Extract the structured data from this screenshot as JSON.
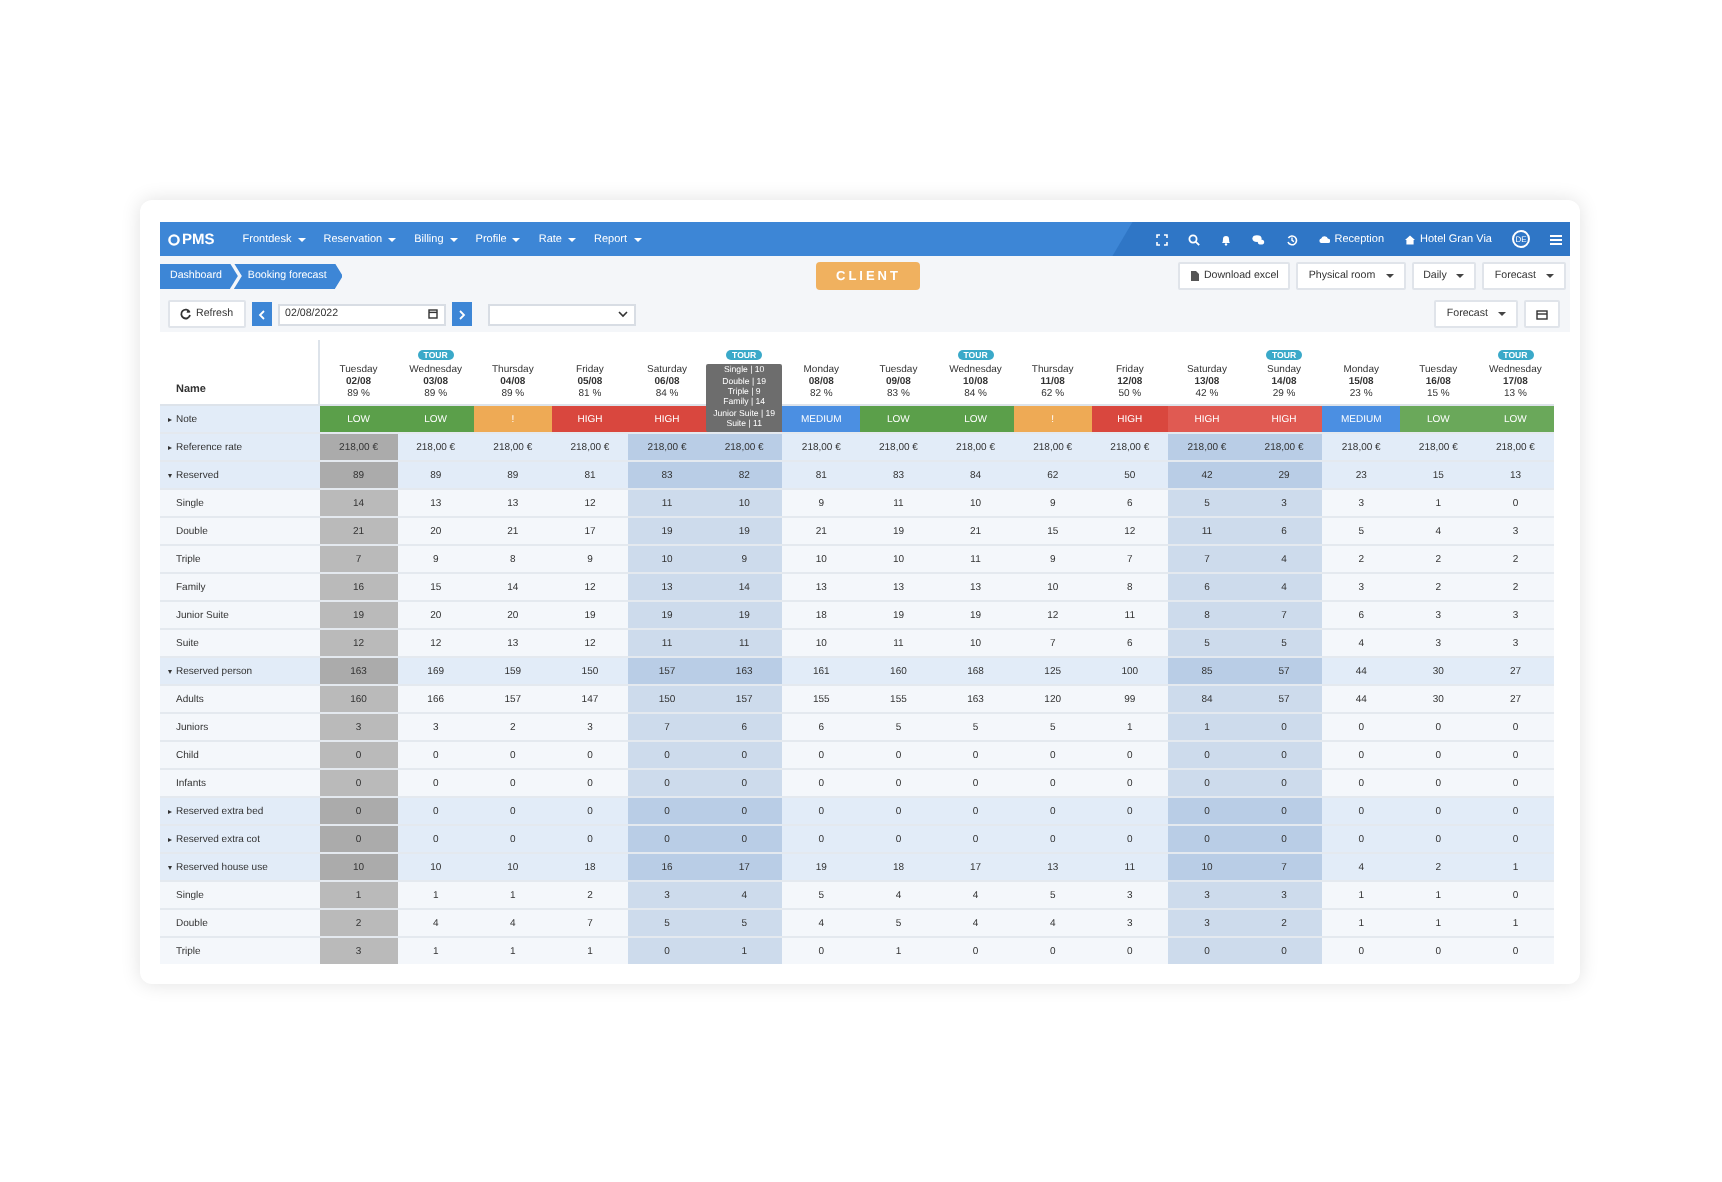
{
  "navbar": {
    "logo": "PMS",
    "menu": [
      "Frontdesk",
      "Reservation",
      "Billing",
      "Profile",
      "Rate",
      "Report"
    ],
    "reception": "Reception",
    "hotel": "Hotel Gran Via",
    "avatar": "DE"
  },
  "breadcrumb": [
    "Dashboard",
    "Booking forecast"
  ],
  "badge": "CLIENT",
  "actions": [
    {
      "label": "Download excel",
      "kind": "download"
    },
    {
      "label": "Physical room",
      "kind": "dropdown"
    },
    {
      "label": "Daily",
      "kind": "dropdown"
    },
    {
      "label": "Forecast",
      "kind": "dropdown"
    }
  ],
  "filter": {
    "refresh": "Refresh",
    "date": "02/08/2022",
    "view": "Forecast"
  },
  "table": {
    "name_header": "Name",
    "columns": [
      {
        "day": "Tuesday",
        "date": "02/08",
        "occupancy": "89 %",
        "today": true,
        "weekend": false
      },
      {
        "day": "Wednesday",
        "date": "03/08",
        "occupancy": "89 %",
        "badge": "TOUR",
        "today": false,
        "weekend": false
      },
      {
        "day": "Thursday",
        "date": "04/08",
        "occupancy": "89 %",
        "today": false,
        "weekend": false
      },
      {
        "day": "Friday",
        "date": "05/08",
        "occupancy": "81 %",
        "today": false,
        "weekend": false
      },
      {
        "day": "Saturday",
        "date": "06/08",
        "occupancy": "84 %",
        "today": false,
        "weekend": true
      },
      {
        "badge": "TOUR",
        "today": false,
        "weekend": true,
        "tooltip": [
          "Single | 10",
          "Double | 19",
          "Triple | 9",
          "Family | 14",
          "Junior Suite | 19",
          "Suite | 11"
        ]
      },
      {
        "day": "Monday",
        "date": "08/08",
        "occupancy": "82 %",
        "today": false,
        "weekend": false
      },
      {
        "day": "Tuesday",
        "date": "09/08",
        "occupancy": "83 %",
        "today": false,
        "weekend": false
      },
      {
        "day": "Wednesday",
        "date": "10/08",
        "occupancy": "84 %",
        "badge": "TOUR",
        "today": false,
        "weekend": false
      },
      {
        "day": "Thursday",
        "date": "11/08",
        "occupancy": "62 %",
        "today": false,
        "weekend": false
      },
      {
        "day": "Friday",
        "date": "12/08",
        "occupancy": "50 %",
        "today": false,
        "weekend": false
      },
      {
        "day": "Saturday",
        "date": "13/08",
        "occupancy": "42 %",
        "today": false,
        "weekend": true
      },
      {
        "day": "Sunday",
        "date": "14/08",
        "occupancy": "29 %",
        "badge": "TOUR",
        "today": false,
        "weekend": true
      },
      {
        "day": "Monday",
        "date": "15/08",
        "occupancy": "23 %",
        "today": false,
        "weekend": false
      },
      {
        "day": "Tuesday",
        "date": "16/08",
        "occupancy": "15 %",
        "today": false,
        "weekend": false
      },
      {
        "day": "Wednesday",
        "date": "17/08",
        "occupancy": "13 %",
        "badge": "TOUR",
        "today": false,
        "weekend": false
      }
    ],
    "rows": [
      {
        "label": "Note",
        "kind": "note",
        "expanded": false,
        "notes": [
          {
            "label": "LOW",
            "color": "#5b9f4a"
          },
          {
            "label": "LOW",
            "color": "#5b9f4a"
          },
          {
            "label": "!",
            "color": "#eeaa55"
          },
          {
            "label": "HIGH",
            "color": "#d9473e"
          },
          {
            "label": "HIGH",
            "color": "#d9473e"
          },
          {
            "color": "#d9473e"
          },
          {
            "label": "MEDIUM",
            "color": "#4b8fe2"
          },
          {
            "label": "LOW",
            "color": "#5b9f4a"
          },
          {
            "label": "LOW",
            "color": "#5b9f4a"
          },
          {
            "label": "!",
            "color": "#eeaa55"
          },
          {
            "label": "HIGH",
            "color": "#d9473e"
          },
          {
            "label": "HIGH",
            "color": "#e05a52"
          },
          {
            "label": "HIGH",
            "color": "#e05a52"
          },
          {
            "label": "MEDIUM",
            "color": "#4b8fe2"
          },
          {
            "label": "LOW",
            "color": "#6aa85a"
          },
          {
            "label": "LOW",
            "color": "#6aa85a"
          }
        ]
      },
      {
        "label": "Reference rate",
        "kind": "group",
        "expanded": false,
        "values": [
          "218,00 €",
          "218,00 €",
          "218,00 €",
          "218,00 €",
          "218,00 €",
          "218,00 €",
          "218,00 €",
          "218,00 €",
          "218,00 €",
          "218,00 €",
          "218,00 €",
          "218,00 €",
          "218,00 €",
          "218,00 €",
          "218,00 €",
          "218,00 €"
        ]
      },
      {
        "label": "Reserved",
        "kind": "group",
        "expanded": true,
        "values": [
          "89",
          "89",
          "89",
          "81",
          "83",
          "82",
          "81",
          "83",
          "84",
          "62",
          "50",
          "42",
          "29",
          "23",
          "15",
          "13"
        ]
      },
      {
        "label": "Single",
        "kind": "item",
        "values": [
          "14",
          "13",
          "13",
          "12",
          "11",
          "10",
          "9",
          "11",
          "10",
          "9",
          "6",
          "5",
          "3",
          "3",
          "1",
          "0"
        ]
      },
      {
        "label": "Double",
        "kind": "item",
        "values": [
          "21",
          "20",
          "21",
          "17",
          "19",
          "19",
          "21",
          "19",
          "21",
          "15",
          "12",
          "11",
          "6",
          "5",
          "4",
          "3"
        ]
      },
      {
        "label": "Triple",
        "kind": "item",
        "values": [
          "7",
          "9",
          "8",
          "9",
          "10",
          "9",
          "10",
          "10",
          "11",
          "9",
          "7",
          "7",
          "4",
          "2",
          "2",
          "2"
        ]
      },
      {
        "label": "Family",
        "kind": "item",
        "values": [
          "16",
          "15",
          "14",
          "12",
          "13",
          "14",
          "13",
          "13",
          "13",
          "10",
          "8",
          "6",
          "4",
          "3",
          "2",
          "2"
        ]
      },
      {
        "label": "Junior Suite",
        "kind": "item",
        "values": [
          "19",
          "20",
          "20",
          "19",
          "19",
          "19",
          "18",
          "19",
          "19",
          "12",
          "11",
          "8",
          "7",
          "6",
          "3",
          "3"
        ]
      },
      {
        "label": "Suite",
        "kind": "item",
        "values": [
          "12",
          "12",
          "13",
          "12",
          "11",
          "11",
          "10",
          "11",
          "10",
          "7",
          "6",
          "5",
          "5",
          "4",
          "3",
          "3"
        ]
      },
      {
        "label": "Reserved person",
        "kind": "group",
        "expanded": true,
        "values": [
          "163",
          "169",
          "159",
          "150",
          "157",
          "163",
          "161",
          "160",
          "168",
          "125",
          "100",
          "85",
          "57",
          "44",
          "30",
          "27"
        ]
      },
      {
        "label": "Adults",
        "kind": "item",
        "values": [
          "160",
          "166",
          "157",
          "147",
          "150",
          "157",
          "155",
          "155",
          "163",
          "120",
          "99",
          "84",
          "57",
          "44",
          "30",
          "27"
        ]
      },
      {
        "label": "Juniors",
        "kind": "item",
        "values": [
          "3",
          "3",
          "2",
          "3",
          "7",
          "6",
          "6",
          "5",
          "5",
          "5",
          "1",
          "1",
          "0",
          "0",
          "0",
          "0"
        ]
      },
      {
        "label": "Child",
        "kind": "item",
        "values": [
          "0",
          "0",
          "0",
          "0",
          "0",
          "0",
          "0",
          "0",
          "0",
          "0",
          "0",
          "0",
          "0",
          "0",
          "0",
          "0"
        ]
      },
      {
        "label": "Infants",
        "kind": "item",
        "values": [
          "0",
          "0",
          "0",
          "0",
          "0",
          "0",
          "0",
          "0",
          "0",
          "0",
          "0",
          "0",
          "0",
          "0",
          "0",
          "0"
        ]
      },
      {
        "label": "Reserved extra bed",
        "kind": "group",
        "expanded": false,
        "values": [
          "0",
          "0",
          "0",
          "0",
          "0",
          "0",
          "0",
          "0",
          "0",
          "0",
          "0",
          "0",
          "0",
          "0",
          "0",
          "0"
        ]
      },
      {
        "label": "Reserved extra cot",
        "kind": "group",
        "expanded": false,
        "values": [
          "0",
          "0",
          "0",
          "0",
          "0",
          "0",
          "0",
          "0",
          "0",
          "0",
          "0",
          "0",
          "0",
          "0",
          "0",
          "0"
        ]
      },
      {
        "label": "Reserved house use",
        "kind": "group",
        "expanded": true,
        "values": [
          "10",
          "10",
          "10",
          "18",
          "16",
          "17",
          "19",
          "18",
          "17",
          "13",
          "11",
          "10",
          "7",
          "4",
          "2",
          "1"
        ]
      },
      {
        "label": "Single",
        "kind": "item",
        "values": [
          "1",
          "1",
          "1",
          "2",
          "3",
          "4",
          "5",
          "4",
          "4",
          "5",
          "3",
          "3",
          "3",
          "1",
          "1",
          "0"
        ]
      },
      {
        "label": "Double",
        "kind": "item",
        "values": [
          "2",
          "4",
          "4",
          "7",
          "5",
          "5",
          "4",
          "5",
          "4",
          "4",
          "3",
          "3",
          "2",
          "1",
          "1",
          "1"
        ]
      },
      {
        "label": "Triple",
        "kind": "item",
        "values": [
          "3",
          "1",
          "1",
          "1",
          "0",
          "1",
          "0",
          "1",
          "0",
          "0",
          "0",
          "0",
          "0",
          "0",
          "0",
          "0"
        ]
      }
    ]
  }
}
